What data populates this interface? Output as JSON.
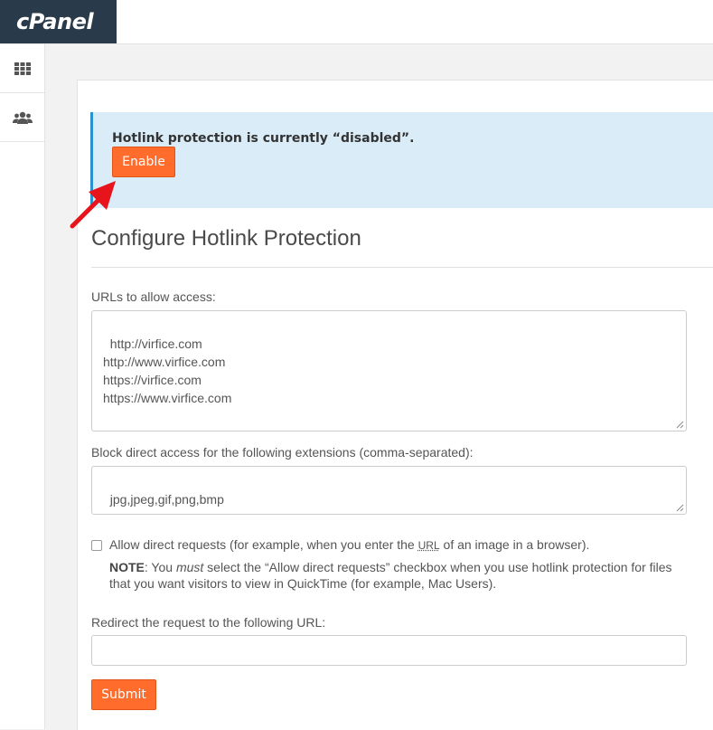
{
  "brand": {
    "logo_text": "cPanel"
  },
  "sidebar": {
    "items": [
      {
        "icon": "grid-icon",
        "label": "Home"
      },
      {
        "icon": "users-icon",
        "label": "User Manager"
      }
    ]
  },
  "alert": {
    "message": "Hotlink protection is currently “disabled”.",
    "enable_label": "Enable"
  },
  "section": {
    "title": "Configure Hotlink Protection"
  },
  "form": {
    "allowed_urls_label": "URLs to allow access:",
    "allowed_urls_value": "http://virfice.com\nhttp://www.virfice.com\nhttps://virfice.com\nhttps://www.virfice.com",
    "extensions_label": "Block direct access for the following extensions (comma-separated):",
    "extensions_value": "jpg,jpeg,gif,png,bmp",
    "direct_requests": {
      "label_before": "Allow direct requests (for example, when you enter the ",
      "label_abbr": "URL",
      "label_after": " of an image in a browser).",
      "checked": false
    },
    "note": {
      "prefix": "NOTE",
      "text_1": ": You ",
      "emphasis": "must",
      "text_2": " select the “Allow direct requests” checkbox when you use hotlink protection for files that you want visitors to view in QuickTime (for example, Mac Users)."
    },
    "redirect_label": "Redirect the request to the following URL:",
    "redirect_value": "",
    "submit_label": "Submit"
  },
  "colors": {
    "accent": "#ff6c2c",
    "alert_bg": "#d9ecf8",
    "alert_border": "#2a91d0",
    "logo_bg": "#293a4a",
    "annotation_arrow": "#e8141c"
  }
}
